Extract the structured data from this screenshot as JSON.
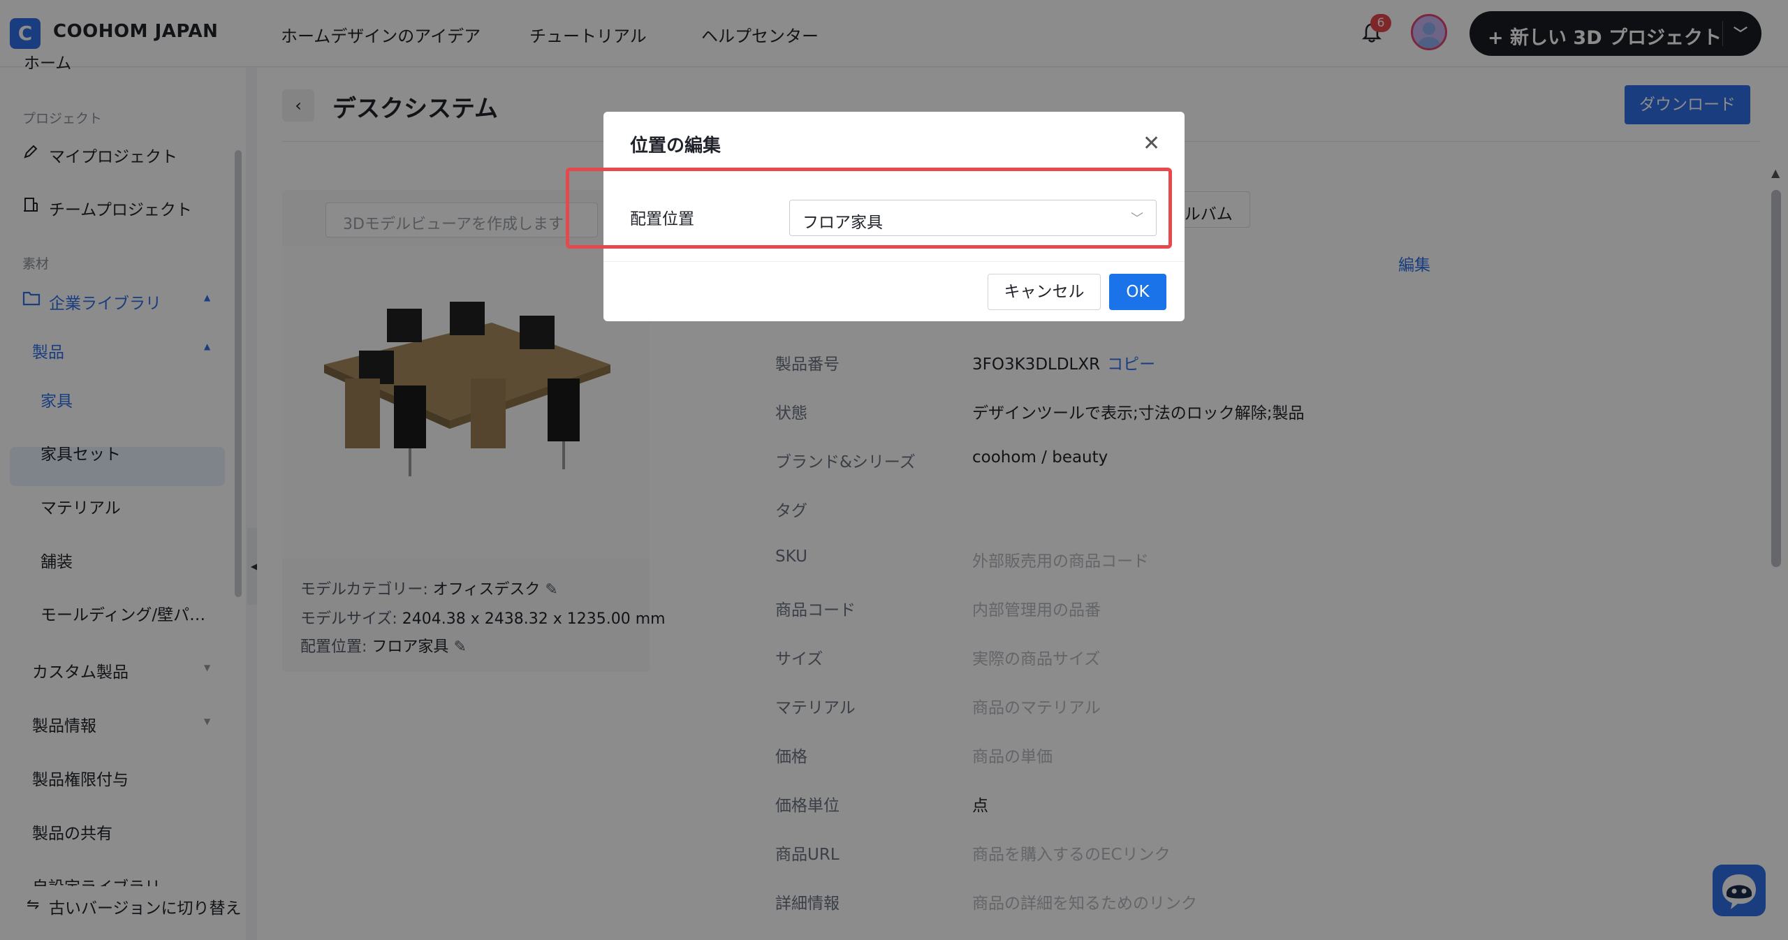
{
  "header": {
    "logo_letter": "C",
    "brand": "COOHOM JAPAN",
    "nav": [
      "ホームデザインのアイデア",
      "チュートリアル",
      "ヘルプセンター"
    ],
    "notification_count": "6",
    "new_project_label": "+ 新しい 3D プロジェクト"
  },
  "sidebar": {
    "home_partial": "ホーム",
    "project_section": "プロジェクト",
    "my_projects": "マイプロジェクト",
    "team_projects": "チームプロジェクト",
    "material_section": "素材",
    "enterprise_library": "企業ライブラリ",
    "products": "製品",
    "items": [
      "家具",
      "家具セット",
      "マテリアル",
      "舗装",
      "モールディング/壁パ…"
    ],
    "custom_products": "カスタム製品",
    "product_info": "製品情報",
    "product_permissions": "製品権限付与",
    "product_sharing": "製品の共有",
    "custom_library": "自設定ライブラリ",
    "switch_old": "古いバージョンに切り替え"
  },
  "page": {
    "title": "デスクシステム",
    "download": "ダウンロード",
    "viewer_placeholder": "3Dモデルビューアを作成します",
    "tab_album": "アルバム",
    "edit": "編集",
    "meta": {
      "category_label": "モデルカテゴリー:",
      "category_value": "オフィスデスク",
      "size_label": "モデルサイズ:",
      "size_value": "2404.38 x 2438.32 x 1235.00 mm",
      "placement_label": "配置位置:",
      "placement_value": "フロア家具"
    },
    "info": [
      {
        "label": "製品番号",
        "value": "3FO3K3DLDLXR",
        "placeholder": false
      },
      {
        "label": "状態",
        "value": "デザインツールで表示;寸法のロック解除;製品",
        "placeholder": false
      },
      {
        "label": "ブランド&シリーズ",
        "value": "coohom / beauty",
        "placeholder": false
      },
      {
        "label": "タグ",
        "value": "",
        "placeholder": false
      },
      {
        "label": "SKU",
        "value": "外部販売用の商品コード",
        "placeholder": true
      },
      {
        "label": "商品コード",
        "value": "内部管理用の品番",
        "placeholder": true
      },
      {
        "label": "サイズ",
        "value": "実際の商品サイズ",
        "placeholder": true
      },
      {
        "label": "マテリアル",
        "value": "商品のマテリアル",
        "placeholder": true
      },
      {
        "label": "価格",
        "value": "商品の単価",
        "placeholder": true
      },
      {
        "label": "価格単位",
        "value": "点",
        "placeholder": false
      },
      {
        "label": "商品URL",
        "value": "商品を購入するのECリンク",
        "placeholder": true
      },
      {
        "label": "詳細情報",
        "value": "商品の詳細を知るためのリンク",
        "placeholder": true
      }
    ],
    "copy": "コピー"
  },
  "modal": {
    "title": "位置の編集",
    "field_label": "配置位置",
    "select_value": "フロア家具",
    "cancel": "キャンセル",
    "ok": "OK"
  },
  "colors": {
    "accent": "#2f6fe8",
    "highlight": "#e5484d"
  }
}
